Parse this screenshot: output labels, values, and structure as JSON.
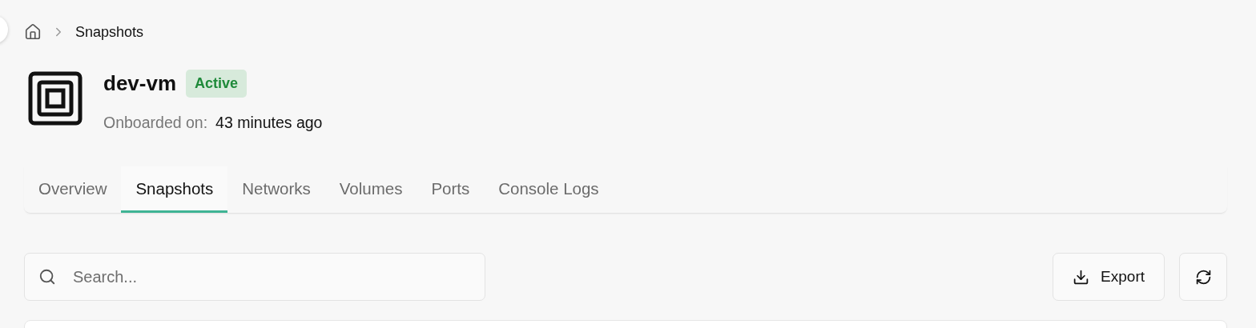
{
  "breadcrumb": {
    "current": "Snapshots"
  },
  "header": {
    "name": "dev-vm",
    "status": {
      "label": "Active",
      "kind": "success"
    },
    "meta_label": "Onboarded on:",
    "meta_value": "43 minutes ago"
  },
  "tabs": [
    {
      "label": "Overview",
      "selected": false
    },
    {
      "label": "Snapshots",
      "selected": true
    },
    {
      "label": "Networks",
      "selected": false
    },
    {
      "label": "Volumes",
      "selected": false
    },
    {
      "label": "Ports",
      "selected": false
    },
    {
      "label": "Console Logs",
      "selected": false
    }
  ],
  "search": {
    "placeholder": "Search..."
  },
  "actions": {
    "export": "Export"
  }
}
